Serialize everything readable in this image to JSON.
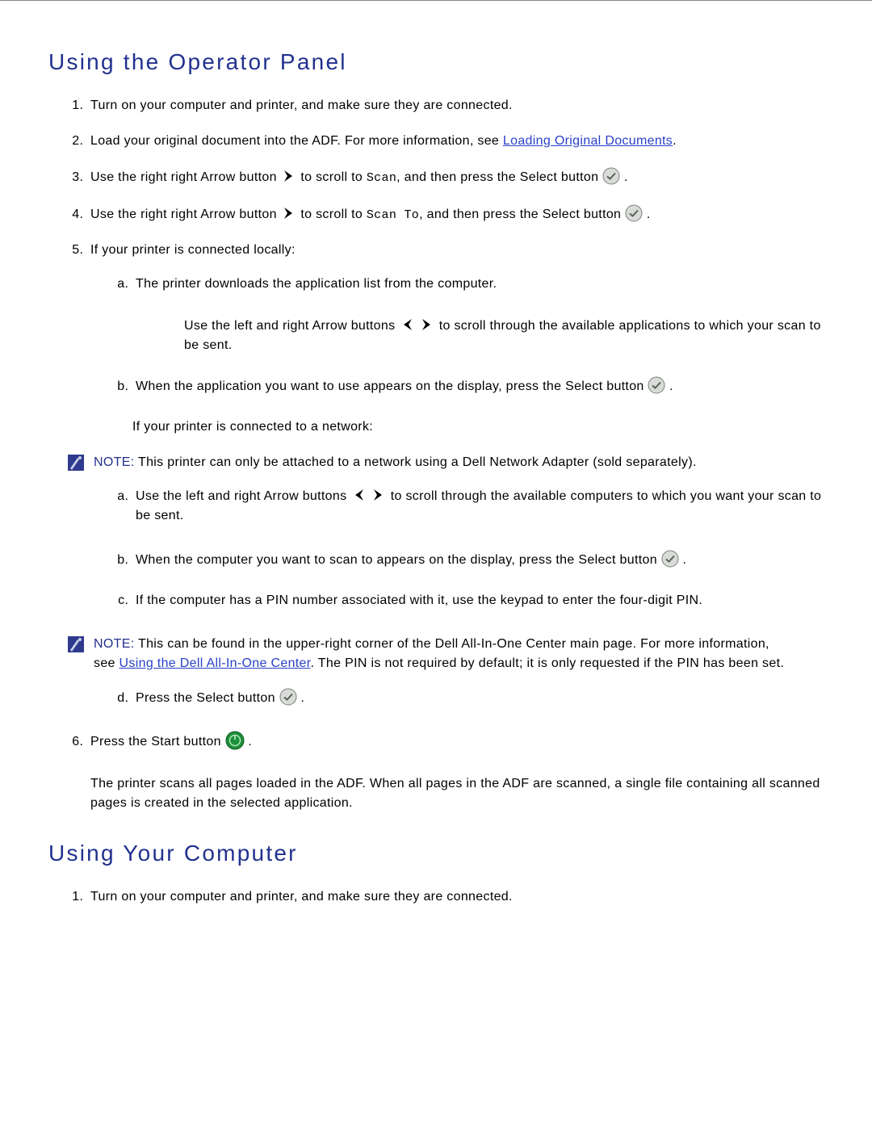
{
  "section1": {
    "heading": "Using the Operator Panel",
    "li1": "Turn on your computer and printer, and make sure they are connected.",
    "li2_a": "Load your original document into the ADF. For more information, see ",
    "li2_link": "Loading Original Documents",
    "li2_b": ".",
    "li3_a": "Use the right right Arrow button ",
    "li3_b": " to scroll to ",
    "li3_code": "Scan",
    "li3_c": ", and then press the Select button ",
    "li3_d": ".",
    "li4_a": "Use the right right Arrow button ",
    "li4_b": " to scroll to ",
    "li4_code": "Scan To",
    "li4_c": ", and then press the Select button ",
    "li4_d": ".",
    "li5": "If your printer is connected locally:",
    "li5a": "The printer downloads the application list from the computer.",
    "li5_sub_a": "Use the left and right Arrow buttons ",
    "li5_sub_b": " to scroll through the available applications to which your scan to be sent.",
    "li5b_a": "When the application you want to use appears on the display, press the Select button ",
    "li5b_b": ".",
    "net_intro": "If your printer is connected to a network:",
    "note1_label": "NOTE:",
    "note1_body": " This printer can only be attached to a network using a Dell Network Adapter (sold separately).",
    "net_a_a": "Use the left and right Arrow buttons ",
    "net_a_b": " to scroll through the available computers to which you want your scan to be sent.",
    "net_b_a": "When the computer you want to scan to appears on the display, press the Select button ",
    "net_b_b": ".",
    "net_c": "If the computer has a PIN number associated with it, use the keypad to enter the four-digit PIN.",
    "note2_label": "NOTE:",
    "note2_a": " This can be found in the upper-right corner of the Dell All-In-One Center main page. For more information, see ",
    "note2_link": "Using the Dell All-In-One Center",
    "note2_b": ". The PIN is not required by default; it is only requested if the PIN has been set.",
    "net_d_a": "Press the Select button ",
    "net_d_b": ".",
    "li6_a": "Press the Start button ",
    "li6_b": ".",
    "li6_after": "The printer scans all pages loaded in the ADF. When all pages in the ADF are scanned, a single file containing all scanned pages is created in the selected application."
  },
  "section2": {
    "heading": "Using Your Computer",
    "li1": "Turn on your computer and printer, and make sure they are connected."
  }
}
